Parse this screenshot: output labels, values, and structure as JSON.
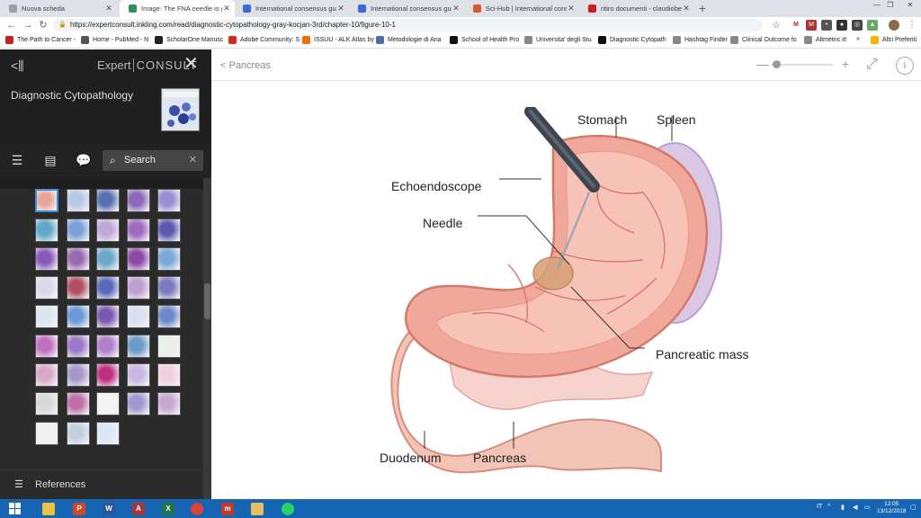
{
  "browser": {
    "tabs": [
      {
        "title": "Nuova scheda",
        "active": false,
        "color": "#9aa0a6"
      },
      {
        "title": "Image: The FNA needle is guide",
        "active": true,
        "color": "#2f8f5a"
      },
      {
        "title": "International consensus guideli",
        "active": false,
        "color": "#3d6ad6"
      },
      {
        "title": "International consensus guideli",
        "active": false,
        "color": "#3d6ad6"
      },
      {
        "title": "Sci-Hub | International consens",
        "active": false,
        "color": "#d35a32"
      },
      {
        "title": "ritiro documenti - claudiobellevi",
        "active": false,
        "color": "#c5221f"
      }
    ],
    "url": "https://expertconsult.inkling.com/read/diagnostic-cytopathology-gray-kocjan-3rd/chapter-10/figure-10-1",
    "bookmarks": [
      {
        "label": "The Path to Cancer -",
        "color": "#c5221f"
      },
      {
        "label": "Home - PubMed - N",
        "color": "#555555"
      },
      {
        "label": "ScholarOne Manusc",
        "color": "#222222"
      },
      {
        "label": "Adobe Community: S",
        "color": "#d4291c"
      },
      {
        "label": "ISSUU - ALK Atlas by",
        "color": "#e8710a"
      },
      {
        "label": "Metodologie di Ana",
        "color": "#4a6ea8"
      },
      {
        "label": "School of Health Pro",
        "color": "#111111"
      },
      {
        "label": "Universita' degli Stu",
        "color": "#888888"
      },
      {
        "label": "Diagnostic Cytopath",
        "color": "#111111"
      },
      {
        "label": "Hashtag Finder",
        "color": "#888888"
      },
      {
        "label": "Clinical Outcome fo",
        "color": "#888888"
      },
      {
        "label": "Altmetric it!",
        "color": "#888888"
      },
      {
        "label": "Altri Preferiti",
        "color": "#f4b400"
      }
    ]
  },
  "sidebar": {
    "brand_expert": "Expert",
    "brand_consult": "CONSULT",
    "book_title": "Diagnostic Cytopathology",
    "search_placeholder": "Search",
    "references_label": "References",
    "thumb_colors": [
      "#e8a59a",
      "#b9c7e6",
      "#5a6fb0",
      "#8a6ab8",
      "#9a8fd0",
      "#5fa8c8",
      "#7aa0d8",
      "#c0a8d8",
      "#a06ac0",
      "#5a5ab0",
      "#8a5ab8",
      "#9a6ab0",
      "#6aa8c8",
      "#8a4aa8",
      "#7aa8d8",
      "#d8d8e8",
      "#b05060",
      "#5a6ab8",
      "#c0a0d0",
      "#7a7ac0",
      "#dce6f0",
      "#6a9ad8",
      "#7a5ab0",
      "#d8e0f0",
      "#6a8ac8",
      "#c070c0",
      "#9a7ac8",
      "#b080c8",
      "#6a9ac8",
      "#e8f0e8",
      "#d8a8c8",
      "#a898c8",
      "#c03080",
      "#c8b8e0",
      "#f0d0e0",
      "#d8d8d8",
      "#c070a8",
      "#f4f4f4",
      "#a098d0",
      "#c8a8d0",
      "#f0f0f0",
      "#c0d0e0",
      "#d8e8f4"
    ]
  },
  "viewer": {
    "breadcrumb": "< Pancreas",
    "figure_labels": {
      "stomach": "Stomach",
      "spleen": "Spleen",
      "echoendoscope": "Echoendoscope",
      "needle": "Needle",
      "pancreatic_mass": "Pancreatic mass",
      "duodenum": "Duodenum",
      "pancreas": "Pancreas"
    }
  },
  "taskbar": {
    "apps": [
      {
        "name": "file-explorer",
        "glyph": "",
        "color": "#f0c040"
      },
      {
        "name": "powerpoint",
        "glyph": "P",
        "color": "#d24726"
      },
      {
        "name": "word",
        "glyph": "W",
        "color": "#2b579a"
      },
      {
        "name": "access",
        "glyph": "A",
        "color": "#a4373a"
      },
      {
        "name": "excel",
        "glyph": "X",
        "color": "#217346"
      },
      {
        "name": "chrome",
        "glyph": "",
        "color": "#db4437"
      },
      {
        "name": "app-red",
        "glyph": "m",
        "color": "#c0392b"
      },
      {
        "name": "app-user",
        "glyph": "",
        "color": "#e8c060"
      },
      {
        "name": "whatsapp",
        "glyph": "",
        "color": "#25d366"
      }
    ],
    "language": "IT",
    "time": "12:05",
    "date": "13/12/2018"
  }
}
